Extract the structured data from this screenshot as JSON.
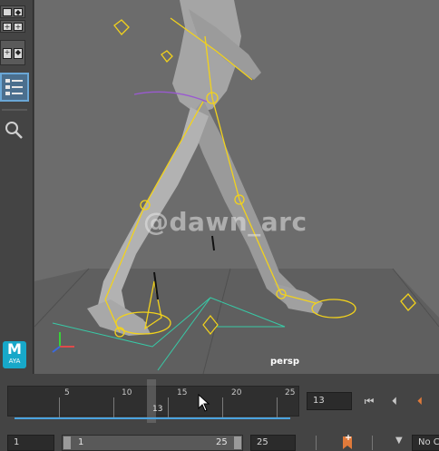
{
  "viewport": {
    "camera_label": "persp",
    "watermark": "@dawn_arc"
  },
  "toolbox": {
    "logo_text": "M",
    "logo_sub": "AYA"
  },
  "timeline": {
    "tick_labels": [
      "5",
      "10",
      "15",
      "20",
      "25"
    ],
    "current_frame": "13",
    "current_frame_field": "13"
  },
  "range": {
    "start_field": "1",
    "range_start": "1",
    "range_end": "25",
    "end_field": "25",
    "no_char_label": "No C"
  },
  "colors": {
    "accent": "#4aa3df",
    "rig": "#f2d21c",
    "key_marker": "#e07a3a"
  }
}
